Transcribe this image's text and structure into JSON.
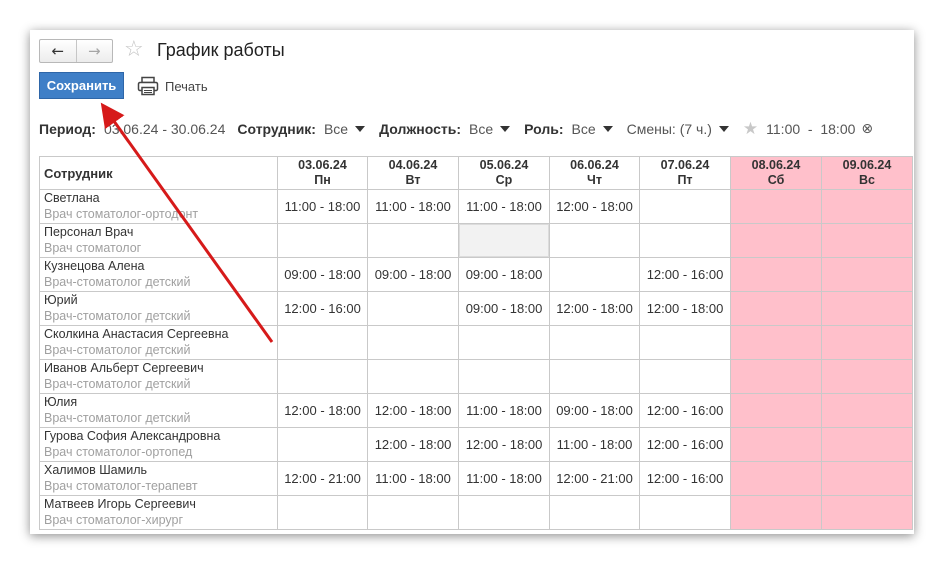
{
  "nav": {
    "back_icon": "←",
    "forward_icon": "→"
  },
  "header": {
    "star_icon": "☆",
    "title": "График работы"
  },
  "toolbar": {
    "save_label": "Сохранить",
    "print_label": "Печать"
  },
  "filters": {
    "period_label": "Период:",
    "period_value": "03.06.24 - 30.06.24",
    "employee_label": "Сотрудник:",
    "employee_value": "Все",
    "position_label": "Должность:",
    "position_value": "Все",
    "role_label": "Роль:",
    "role_value": "Все",
    "shifts_label": "Смены: (7 ч.)",
    "shift_star_icon": "★",
    "shift_time": "11:00  -  18:00",
    "shift_close_icon": "⊗"
  },
  "table": {
    "name_header": "Сотрудник",
    "days": [
      {
        "date": "03.06.24",
        "dow": "Пн",
        "weekend": false
      },
      {
        "date": "04.06.24",
        "dow": "Вт",
        "weekend": false
      },
      {
        "date": "05.06.24",
        "dow": "Ср",
        "weekend": false
      },
      {
        "date": "06.06.24",
        "dow": "Чт",
        "weekend": false
      },
      {
        "date": "07.06.24",
        "dow": "Пт",
        "weekend": false
      },
      {
        "date": "08.06.24",
        "dow": "Сб",
        "weekend": true
      },
      {
        "date": "09.06.24",
        "dow": "Вс",
        "weekend": true
      }
    ],
    "rows": [
      {
        "name": "Светлана",
        "role": "Врач стоматолог-ортодонт",
        "shifts": [
          "11:00 - 18:00",
          "11:00 - 18:00",
          "11:00 - 18:00",
          "12:00 - 18:00",
          "",
          "",
          ""
        ]
      },
      {
        "name": "Персонал Врач",
        "role": "Врач стоматолог",
        "shifts": [
          "",
          "",
          "",
          "",
          "",
          "",
          ""
        ]
      },
      {
        "name": "Кузнецова Алена",
        "role": "Врач-стоматолог детский",
        "shifts": [
          "09:00 - 18:00",
          "09:00 - 18:00",
          "09:00 - 18:00",
          "",
          "12:00 - 16:00",
          "",
          ""
        ]
      },
      {
        "name": "Юрий",
        "role": "Врач-стоматолог детский",
        "shifts": [
          "12:00 - 16:00",
          "",
          "09:00 - 18:00",
          "12:00 - 18:00",
          "12:00 - 18:00",
          "",
          ""
        ]
      },
      {
        "name": "Сколкина Анастасия Сергеевна",
        "role": "Врач-стоматолог детский",
        "shifts": [
          "",
          "",
          "",
          "",
          "",
          "",
          ""
        ]
      },
      {
        "name": "Иванов Альберт Сергеевич",
        "role": "Врач-стоматолог детский",
        "shifts": [
          "",
          "",
          "",
          "",
          "",
          "",
          ""
        ]
      },
      {
        "name": "Юлия",
        "role": "Врач-стоматолог детский",
        "shifts": [
          "12:00 - 18:00",
          "12:00 - 18:00",
          "11:00 - 18:00",
          "09:00 - 18:00",
          "12:00 - 16:00",
          "",
          ""
        ]
      },
      {
        "name": "Гурова София Александровна",
        "role": "Врач стоматолог-ортопед",
        "shifts": [
          "",
          "12:00 - 18:00",
          "12:00 - 18:00",
          "11:00 - 18:00",
          "12:00 - 16:00",
          "",
          ""
        ]
      },
      {
        "name": "Халимов Шамиль",
        "role": "Врач стоматолог-терапевт",
        "shifts": [
          "12:00 - 21:00",
          "11:00 - 18:00",
          "11:00 - 18:00",
          "12:00 - 21:00",
          "12:00 - 16:00",
          "",
          ""
        ]
      },
      {
        "name": "Матвеев Игорь Сергеевич",
        "role": "Врач стоматолог-хирург",
        "shifts": [
          "",
          "",
          "",
          "",
          "",
          "",
          ""
        ]
      }
    ]
  },
  "colors": {
    "weekend": "#ffc0cb",
    "save_button": "#3f7fc7",
    "annotation_arrow": "#d61a1a"
  }
}
